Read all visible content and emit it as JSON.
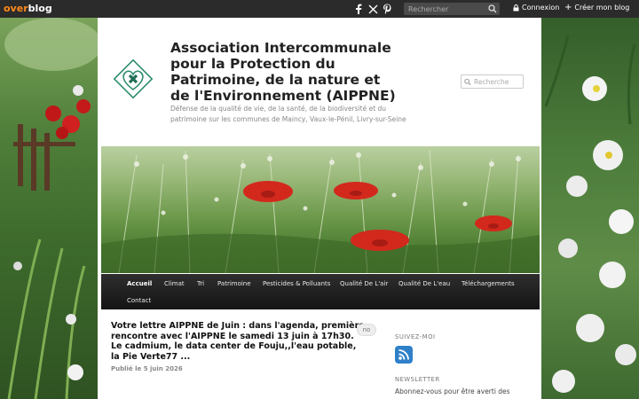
{
  "topbar": {
    "logo_over": "over",
    "logo_blog": "blog",
    "search_placeholder": "Rechercher",
    "connexion_label": "Connexion",
    "create_blog_label": "Créer mon blog",
    "social_icons": [
      "facebook-icon",
      "x-icon",
      "pinterest-icon"
    ]
  },
  "site": {
    "title": "Association Intercommunale pour la Protection du Patrimoine, de la nature et de l'Environnement (AIPPNE)",
    "description": "Défense de la qualité de vie, de la santé, de la biodiversité et du patrimoine sur les communes de Maincy, Vaux-le-Pénil, Livry-sur-Seine",
    "search_placeholder": "Recherche"
  },
  "nav": {
    "items": [
      {
        "label": "Accueil",
        "active": true
      },
      {
        "label": "Climat"
      },
      {
        "label": "Tri"
      },
      {
        "label": "Patrimoine"
      },
      {
        "label": "Pesticides & Polluants"
      },
      {
        "label": "Qualité De L'air"
      },
      {
        "label": "Qualité De L'eau"
      },
      {
        "label": "Téléchargements"
      },
      {
        "label": "Contact"
      }
    ]
  },
  "article": {
    "title": "Votre lettre AIPPNE de Juin : dans l'agenda, première rencontre avec l'AIPPNE le samedi 13 juin à 17h30. Le cadmium, le data center de Fouju,,l'eau potable, la Pie Verte77 ...",
    "comment_badge": "no",
    "published": "Publié le 5 juin 2026"
  },
  "sidebar": {
    "follow_heading": "SUIVEZ-MOI",
    "newsletter_heading": "NEWSLETTER",
    "newsletter_text": "Abonnez-vous pour être averti des"
  },
  "colors": {
    "topbar": "#2b2b2b",
    "logo_orange": "#ff8a1a",
    "nav": "#1c1c1c",
    "rss_blue": "#2f80c9",
    "logo_green": "#2e8b6e"
  }
}
